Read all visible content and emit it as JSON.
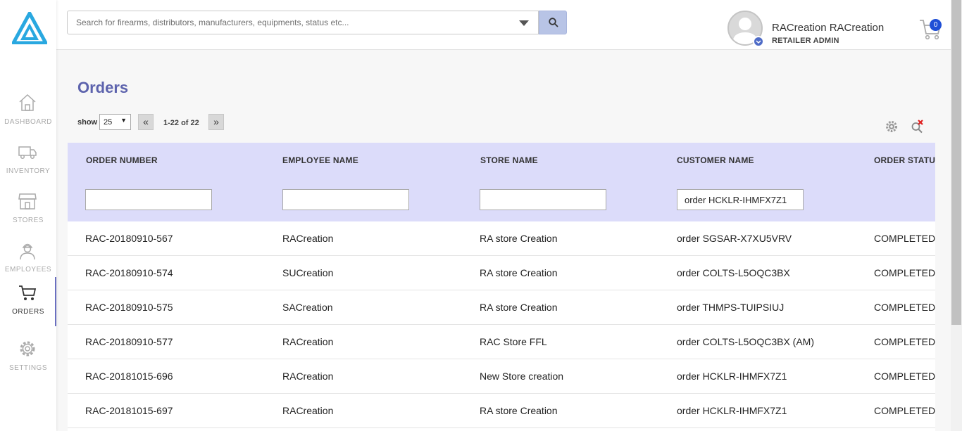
{
  "search": {
    "placeholder": "Search for firearms, distributors, manufacturers, equipments, status etc..."
  },
  "user": {
    "name": "RACreation RACreation",
    "role": "RETAILER ADMIN"
  },
  "cart": {
    "count": "0"
  },
  "sidebar": {
    "items": [
      {
        "label": "DASHBOARD",
        "icon": "home-icon"
      },
      {
        "label": "INVENTORY",
        "icon": "truck-icon"
      },
      {
        "label": "STORES",
        "icon": "store-icon"
      },
      {
        "label": "EMPLOYEES",
        "icon": "employee-icon"
      },
      {
        "label": "ORDERS",
        "icon": "cart-icon",
        "active": true
      },
      {
        "label": "SETTINGS",
        "icon": "gear-icon"
      }
    ]
  },
  "page": {
    "title": "Orders"
  },
  "pager": {
    "show_label": "show",
    "page_size": "25",
    "range": "1-22 of 22",
    "prev": "«",
    "next": "»"
  },
  "table": {
    "headers": [
      "ORDER NUMBER",
      "EMPLOYEE NAME",
      "STORE NAME",
      "CUSTOMER NAME",
      "ORDER STATUS"
    ],
    "filters": [
      "",
      "",
      "",
      "order HCKLR-IHMFX7Z1"
    ],
    "rows": [
      [
        "RAC-20180910-567",
        "RACreation",
        "RA store Creation",
        "order SGSAR-X7XU5VRV",
        "COMPLETED"
      ],
      [
        "RAC-20180910-574",
        "SUCreation",
        "RA store Creation",
        "order COLTS-L5OQC3BX",
        "COMPLETED"
      ],
      [
        "RAC-20180910-575",
        "SACreation",
        "RA store Creation",
        "order THMPS-TUIPSIUJ",
        "COMPLETED"
      ],
      [
        "RAC-20180910-577",
        "RACreation",
        "RAC Store FFL",
        "order COLTS-L5OQC3BX (AM)",
        "COMPLETED"
      ],
      [
        "RAC-20181015-696",
        "RACreation",
        "New Store creation",
        "order HCKLR-IHMFX7Z1",
        "COMPLETED"
      ],
      [
        "RAC-20181015-697",
        "RACreation",
        "RA store Creation",
        "order HCKLR-IHMFX7Z1",
        "COMPLETED"
      ]
    ]
  },
  "colors": {
    "accent": "#5d63ad",
    "header_bg": "#dcdcfa",
    "logo": "#29a8e0",
    "badge": "#1f4fd6"
  }
}
